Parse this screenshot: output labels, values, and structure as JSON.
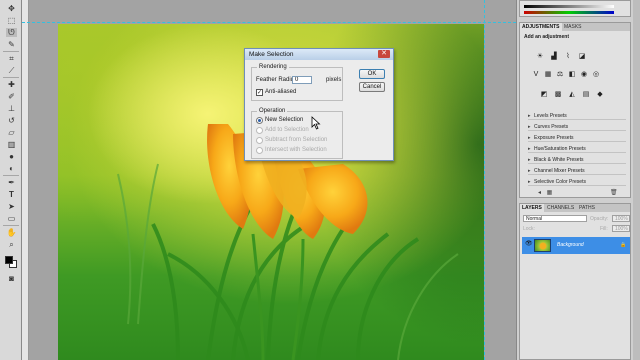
{
  "dialog": {
    "title": "Make Selection",
    "close_glyph": "✕",
    "rendering_legend": "Rendering",
    "feather_label": "Feather Radius:",
    "feather_value": "0",
    "feather_unit": "pixels",
    "antialiased_label": "Anti-aliased",
    "antialiased_checked": true,
    "operation_legend": "Operation",
    "operations": [
      {
        "label": "New Selection",
        "selected": true,
        "enabled": true
      },
      {
        "label": "Add to Selection",
        "selected": false,
        "enabled": false
      },
      {
        "label": "Subtract from Selection",
        "selected": false,
        "enabled": false
      },
      {
        "label": "Intersect with Selection",
        "selected": false,
        "enabled": false
      }
    ],
    "ok_label": "OK",
    "cancel_label": "Cancel"
  },
  "adjustments_panel": {
    "tabs": [
      "ADJUSTMENTS",
      "MASKS"
    ],
    "header": "Add an adjustment",
    "presets": [
      "Levels Presets",
      "Curves Presets",
      "Exposure Presets",
      "Hue/Saturation Presets",
      "Black & White Presets",
      "Channel Mixer Presets",
      "Selective Color Presets"
    ]
  },
  "layers_panel": {
    "tabs": [
      "LAYERS",
      "CHANNELS",
      "PATHS"
    ],
    "blend_mode": "Normal",
    "opacity_label": "Opacity:",
    "opacity_value": "100%",
    "lock_label": "Lock:",
    "fill_label": "Fill:",
    "fill_value": "100%",
    "layer_name": "Background"
  },
  "colors": {
    "selected_layer": "#3d8ee6",
    "guide": "#33c0e0",
    "dialog_titlebar": "#b9cfe8",
    "foreground_color": "#000000",
    "background_color": "#ffffff"
  },
  "icons": {
    "tools": [
      "move-tool",
      "marquee-tool",
      "lasso-tool",
      "quick-select-tool",
      "crop-tool",
      "eyedropper-tool",
      "healing-brush-tool",
      "brush-tool",
      "clone-stamp-tool",
      "history-brush-tool",
      "eraser-tool",
      "gradient-tool",
      "blur-tool",
      "dodge-tool",
      "pen-tool",
      "type-tool",
      "path-select-tool",
      "shape-tool",
      "hand-tool",
      "zoom-tool"
    ]
  }
}
